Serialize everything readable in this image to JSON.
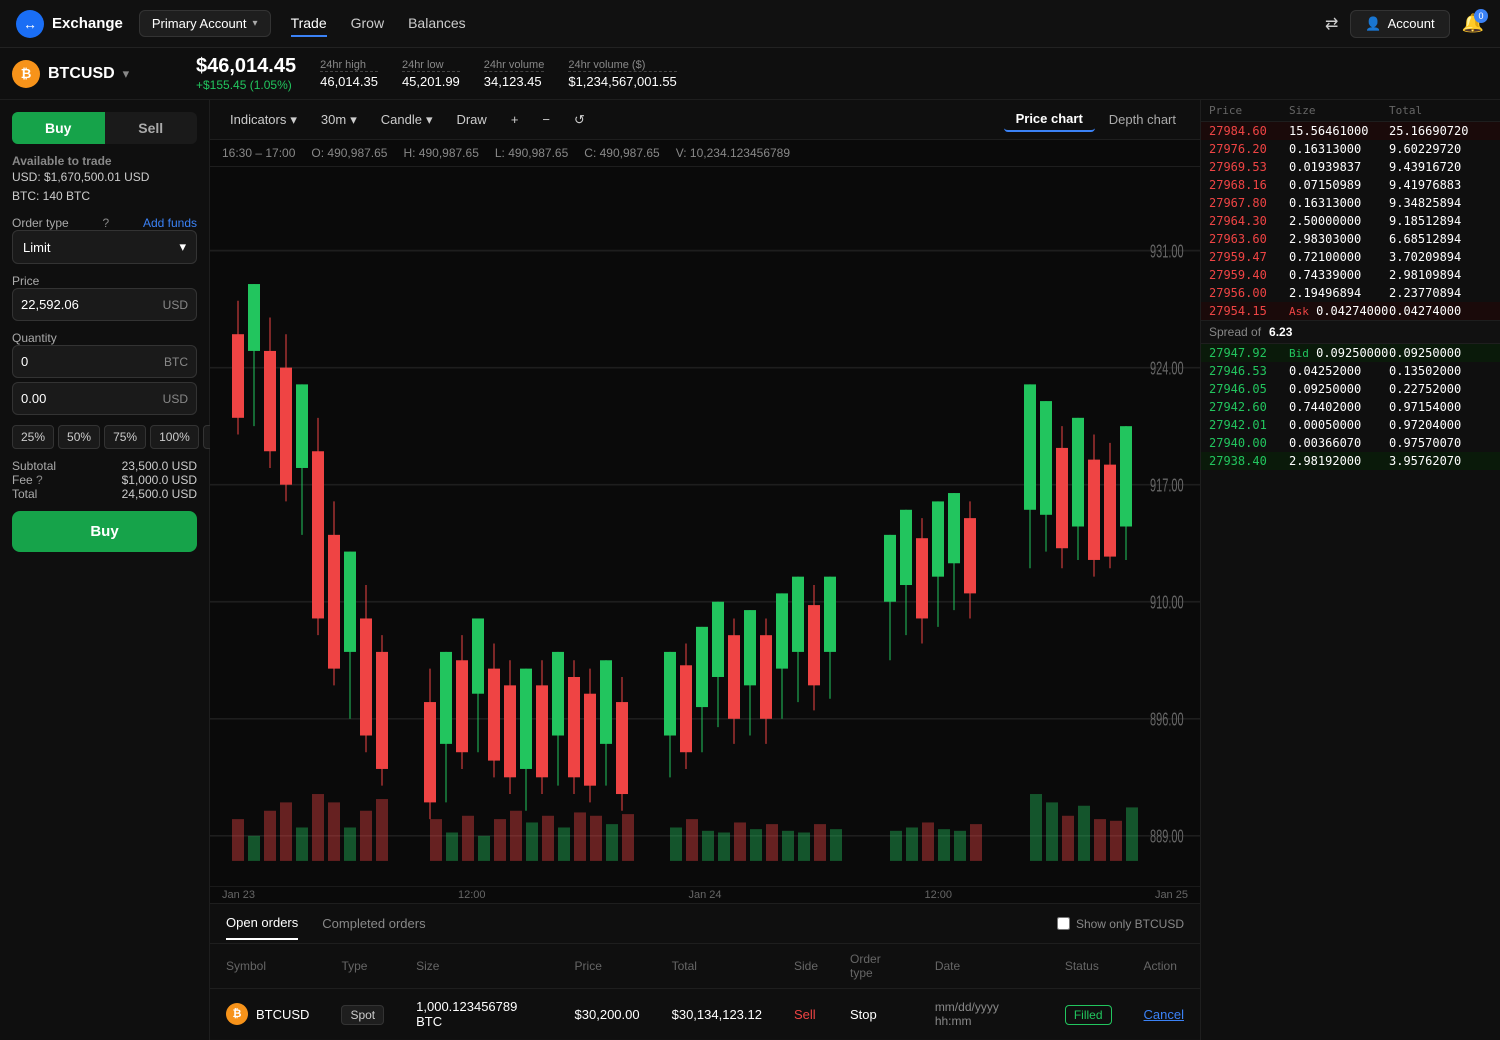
{
  "nav": {
    "logo": "↔",
    "exchange_label": "Exchange",
    "account_btn": "Primary Account",
    "links": [
      "Trade",
      "Grow",
      "Balances"
    ],
    "active_link": "Trade",
    "right_btn": "Account",
    "notif_count": "0"
  },
  "ticker": {
    "symbol": "BTCUSD",
    "icon": "₿",
    "price": "$46,014.45",
    "change": "+$155.45 (1.05%)",
    "stats": [
      {
        "label": "24hr high",
        "value": "46,014.35"
      },
      {
        "label": "24hr low",
        "value": "45,201.99"
      },
      {
        "label": "24hr volume",
        "value": "34,123.45"
      },
      {
        "label": "24hr volume ($)",
        "value": "$1,234,567,001.55"
      }
    ]
  },
  "left_panel": {
    "buy_label": "Buy",
    "sell_label": "Sell",
    "available_label": "Available to trade",
    "usd_available": "USD: $1,670,500.01 USD",
    "btc_available": "BTC: 140 BTC",
    "order_type_label": "Order type",
    "add_funds_label": "Add funds",
    "order_type_value": "Limit",
    "price_label": "Price",
    "price_value": "22,592.06",
    "price_currency": "USD",
    "quantity_label": "Quantity",
    "qty_btc_value": "0",
    "qty_btc_currency": "BTC",
    "qty_usd_value": "0.00",
    "qty_usd_currency": "USD",
    "pct_buttons": [
      "25%",
      "50%",
      "75%",
      "100%",
      "%"
    ],
    "subtotal_label": "Subtotal",
    "subtotal_value": "23,500.0 USD",
    "fee_label": "Fee",
    "fee_value": "$1,000.0 USD",
    "total_label": "Total",
    "total_value": "24,500.0 USD",
    "buy_btn": "Buy"
  },
  "chart": {
    "indicators_label": "Indicators",
    "timeframe_label": "30m",
    "candle_label": "Candle",
    "draw_label": "Draw",
    "price_chart_label": "Price chart",
    "depth_chart_label": "Depth chart",
    "ohlcv": {
      "time": "16:30 – 17:00",
      "open": "O: 490,987.65",
      "high": "H: 490,987.65",
      "low": "L: 490,987.65",
      "close": "C: 490,987.65",
      "volume": "V: 10,234.123456789"
    },
    "price_levels": [
      "931.00",
      "924.00",
      "917.00",
      "910.00",
      "896.00",
      "889.00"
    ],
    "dates": [
      "Jan 23",
      "12:00",
      "Jan 24",
      "12:00",
      "Jan 25"
    ]
  },
  "orderbook": {
    "asks": [
      {
        "price": "27984.60",
        "size": "15.56461000",
        "total": "25.16690720"
      },
      {
        "price": "27976.20",
        "size": "0.16313000",
        "total": "9.60229720"
      },
      {
        "price": "27969.53",
        "size": "0.01939837",
        "total": "9.43916720"
      },
      {
        "price": "27968.16",
        "size": "0.07150989",
        "total": "9.41976883"
      },
      {
        "price": "27967.80",
        "size": "0.16313000",
        "total": "9.34825894"
      },
      {
        "price": "27964.30",
        "size": "2.50000000",
        "total": "9.18512894"
      },
      {
        "price": "27963.60",
        "size": "2.98303000",
        "total": "6.68512894"
      },
      {
        "price": "27959.47",
        "size": "0.72100000",
        "total": "3.70209894"
      },
      {
        "price": "27959.40",
        "size": "0.74339000",
        "total": "2.98109894"
      },
      {
        "price": "27956.00",
        "size": "2.19496894",
        "total": "2.23770894"
      },
      {
        "price": "27954.15",
        "size": "0.04274000",
        "total": "0.04274000",
        "is_ask_label": true
      }
    ],
    "ask_label": "Ask",
    "spread_label": "Spread of",
    "spread_value": "6.23",
    "bid_label": "Bid",
    "bids": [
      {
        "price": "27947.92",
        "size": "0.09250000",
        "total": "0.09250000",
        "is_bid_label": true
      },
      {
        "price": "27946.53",
        "size": "0.04252000",
        "total": "0.13502000"
      },
      {
        "price": "27946.05",
        "size": "0.09250000",
        "total": "0.22752000"
      },
      {
        "price": "27942.60",
        "size": "0.74402000",
        "total": "0.97154000"
      },
      {
        "price": "27942.01",
        "size": "0.00050000",
        "total": "0.97204000"
      },
      {
        "price": "27940.00",
        "size": "0.00366070",
        "total": "0.97570070"
      },
      {
        "price": "27938.40",
        "size": "2.98192000",
        "total": "3.95762070"
      }
    ]
  },
  "orders": {
    "tabs": [
      "Open orders",
      "Completed orders"
    ],
    "active_tab": "Open orders",
    "filter_label": "Show only BTCUSD",
    "columns": [
      "Symbol",
      "Type",
      "Size",
      "Price",
      "Total",
      "Side",
      "Order type",
      "Date",
      "Status",
      "Action"
    ],
    "rows": [
      {
        "symbol": "BTCUSD",
        "type": "Spot",
        "size": "1,000.123456789 BTC",
        "price": "$30,200.00",
        "total": "$30,134,123.12",
        "side": "Sell",
        "order_type": "Stop",
        "date": "mm/dd/yyyy hh:mm",
        "status": "Filled",
        "action": "Cancel"
      }
    ]
  }
}
